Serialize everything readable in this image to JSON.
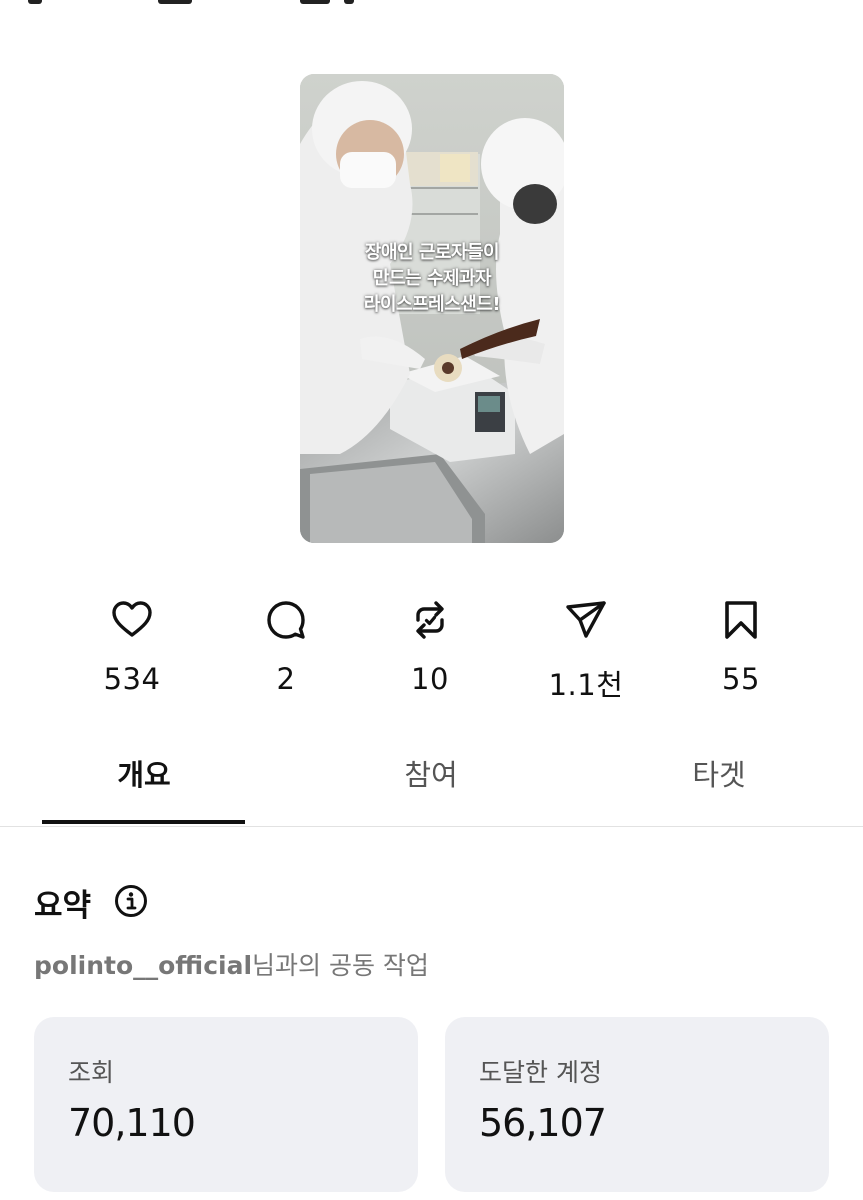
{
  "video": {
    "caption_lines": [
      "장애인 근로자들이",
      "만드는 수제과자",
      "라이스프레스샌드!"
    ]
  },
  "actions": [
    {
      "icon": "heart-icon",
      "count": "534"
    },
    {
      "icon": "comment-icon",
      "count": "2"
    },
    {
      "icon": "repost-icon",
      "count": "10"
    },
    {
      "icon": "share-icon",
      "count": "1.1천"
    },
    {
      "icon": "bookmark-icon",
      "count": "55"
    }
  ],
  "tabs": [
    {
      "label": "개요",
      "active": true
    },
    {
      "label": "참여",
      "active": false
    },
    {
      "label": "타겟",
      "active": false
    }
  ],
  "summary": {
    "title": "요약",
    "collab_handle": "polinto__official",
    "collab_suffix": "님과의 공동 작업"
  },
  "stats": [
    {
      "label": "조회",
      "value": "70,110"
    },
    {
      "label": "도달한 계정",
      "value": "56,107"
    }
  ],
  "colors": {
    "card_bg": "#eff0f4",
    "text_primary": "#111111",
    "text_secondary": "#777777"
  }
}
